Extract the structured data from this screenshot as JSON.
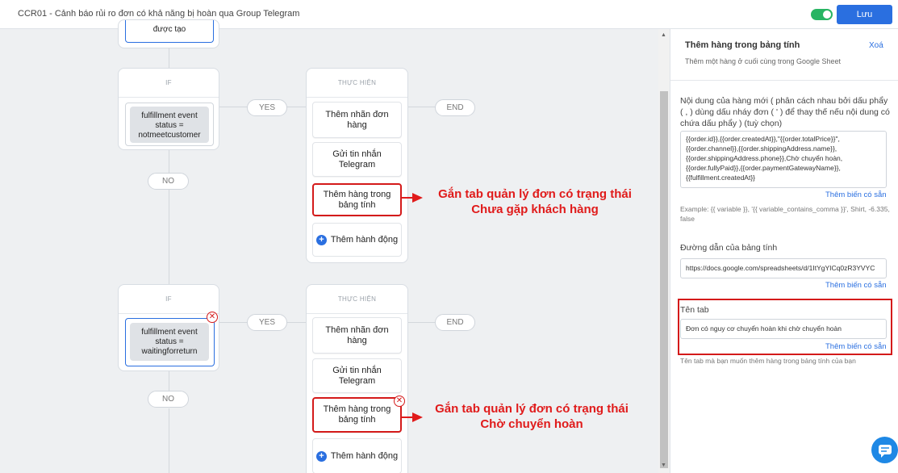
{
  "header": {
    "title": "CCR01 - Cảnh báo rủi ro đơn có khả năng bị hoàn qua Group Telegram",
    "save_label": "Lưu"
  },
  "flow": {
    "top_node_text": "được tạo",
    "blocks": [
      {
        "if_label": "IF",
        "condition": [
          "fulfillment event",
          "status =",
          "notmeetcustomer"
        ],
        "yes_label": "YES",
        "no_label": "NO",
        "end_label": "END",
        "execute_label": "THỰC HIỆN",
        "actions": [
          "Thêm nhãn đơn hàng",
          "Gửi tin nhắn Telegram",
          "Thêm hàng trong bảng tính"
        ],
        "add_action_label": "Thêm hành động",
        "annotation": [
          "Gắn tab quản lý đơn có trạng thái",
          "Chưa gặp khách hàng"
        ]
      },
      {
        "if_label": "IF",
        "condition": [
          "fulfillment event",
          "status =",
          "waitingforreturn"
        ],
        "yes_label": "YES",
        "no_label": "NO",
        "end_label": "END",
        "execute_label": "THỰC HIỆN",
        "actions": [
          "Thêm nhãn đơn hàng",
          "Gửi tin nhắn Telegram",
          "Thêm hàng trong bảng tính"
        ],
        "add_action_label": "Thêm hành động",
        "annotation": [
          "Gắn tab quản lý đơn có trạng thái",
          "Chờ chuyển hoàn"
        ]
      }
    ]
  },
  "panel": {
    "title": "Thêm hàng trong bảng tính",
    "delete_label": "Xoá",
    "subtitle": "Thêm một hàng ở cuối cùng trong Google Sheet",
    "content_label": "Nội dung của hàng mới ( phân cách nhau bởi dấu phẩy ( , ) dùng dấu nháy đơn ( ' ) để thay thế nếu nội dung có chứa dấu phẩy ) (tuỳ chọn)",
    "content_value": "{{order.id}},{{order.createdAt}},\"{{order.totalPrice}}\",{{order.channel}},{{order.shippingAddress.name}},{{order.shippingAddress.phone}},Chờ chuyển hoàn,{{order.fullyPaid}},{{order.paymentGatewayName}},{{fulfillment.createdAt}}",
    "variables_link": "Thêm biến có sẵn",
    "example_text": "Example: {{ variable }}, '{{ variable_contains_comma }}', Shirt, -6.335, false",
    "sheet_url_label": "Đường dẫn của bảng tính",
    "sheet_url_value": "https://docs.google.com/spreadsheets/d/1ItYgYICq0zR3YVYC",
    "tab_label": "Tên tab",
    "tab_value": "Đơn có nguy cơ chuyển hoàn khi chờ chuyển hoàn",
    "tab_hint": "Tên tab mà bạn muốn thêm hàng trong bảng tính của bạn"
  },
  "colors": {
    "accent": "#2a6fe0",
    "highlight": "#d41a1a",
    "toggle_on": "#28b463"
  }
}
